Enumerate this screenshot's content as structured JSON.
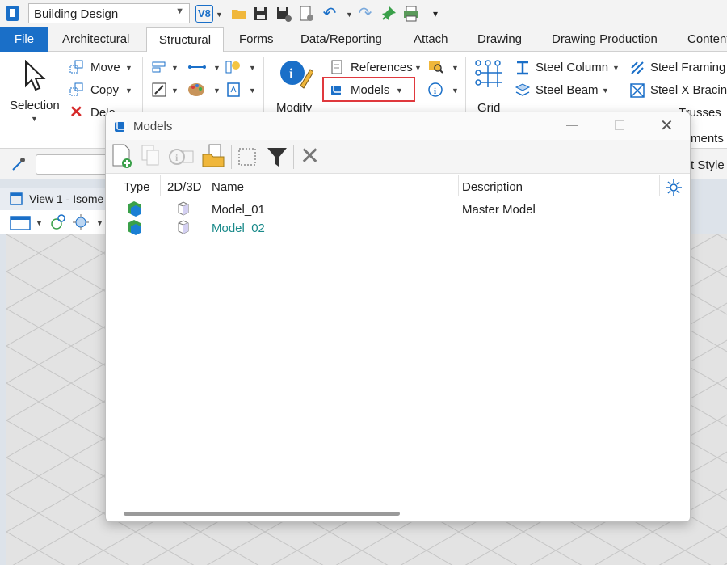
{
  "titlebar": {
    "workspace": "Building Design",
    "version_badge": "V8",
    "icons": [
      "app-icon",
      "v8-icon",
      "open-folder-icon",
      "save-icon",
      "save-settings-icon",
      "properties-icon",
      "undo-icon",
      "redo-icon",
      "pin-icon",
      "print-icon",
      "more-icon"
    ]
  },
  "tabs": {
    "file": "File",
    "architectural": "Architectural",
    "structural": "Structural",
    "forms": "Forms",
    "data_reporting": "Data/Reporting",
    "attach": "Attach",
    "drawing": "Drawing",
    "drawing_production": "Drawing Production",
    "content": "Content"
  },
  "ribbon": {
    "selection": "Selection",
    "move": "Move",
    "copy": "Copy",
    "delete": "Dele",
    "modify": "Modify",
    "references": "References",
    "models": "Models",
    "grid": "Grid",
    "steel_column": "Steel Column",
    "steel_beam": "Steel Beam",
    "steel_framing": "Steel Framing",
    "steel_x_bracing": "Steel X Bracing",
    "trusses": "Trusses",
    "ments": "ments",
    "rt_style": "rt Style"
  },
  "view": {
    "title": "View 1 - Isome"
  },
  "dialog": {
    "title": "Models",
    "headers": {
      "type": "Type",
      "dim": "2D/3D",
      "name": "Name",
      "description": "Description"
    },
    "rows": [
      {
        "name": "Model_01",
        "description": "Master Model",
        "name_color": "#222222"
      },
      {
        "name": "Model_02",
        "description": "",
        "name_color": "#1a8a8a"
      }
    ]
  },
  "colors": {
    "accent": "#1a6fc8",
    "highlight": "#e0393e",
    "active_model_text": "#1a8a8a"
  }
}
